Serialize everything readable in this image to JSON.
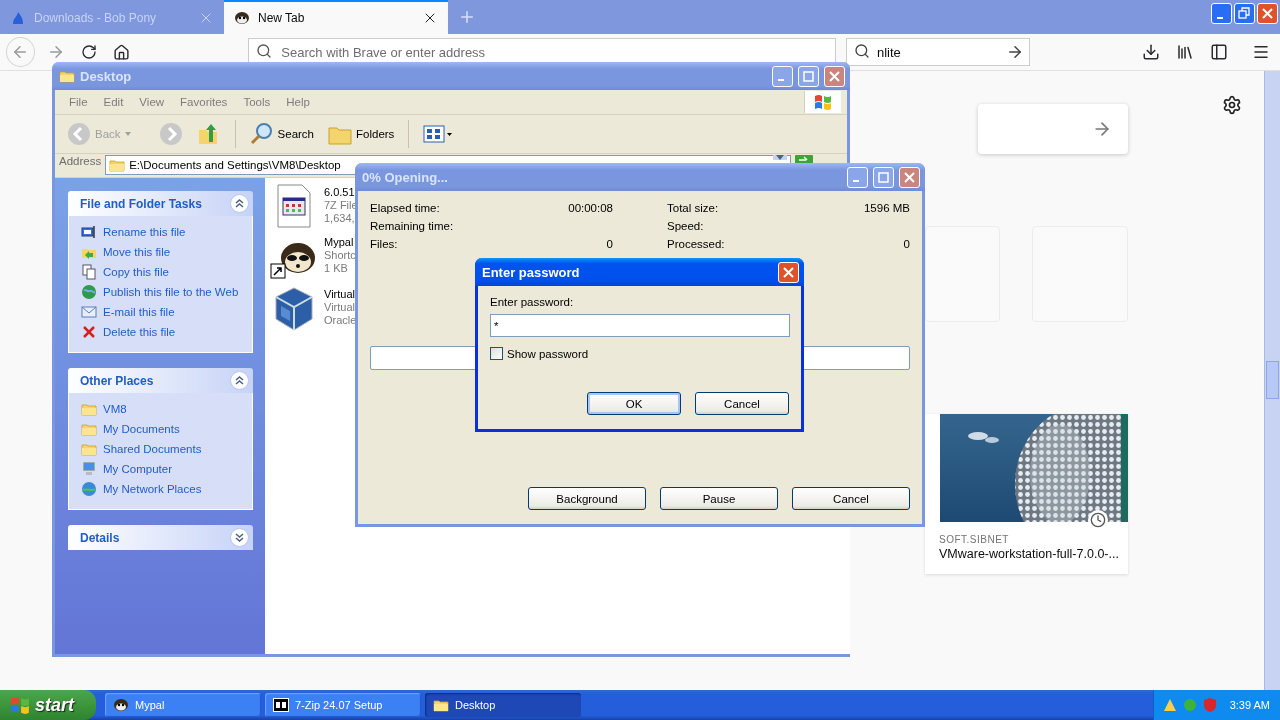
{
  "browser": {
    "tabs": [
      {
        "label": "Downloads - Bob Pony",
        "selected": false,
        "kind": "site"
      },
      {
        "label": "New Tab",
        "selected": true,
        "kind": "mascot"
      }
    ],
    "address": {
      "placeholder": "Search with Brave or enter address"
    },
    "search": {
      "value": "nlite"
    },
    "story": {
      "kind": "picture",
      "source": "SOFT.SIBNET",
      "title": "VMware-workstation-full-7.0.0-..."
    }
  },
  "explorer": {
    "title": "Desktop",
    "menu": [
      "File",
      "Edit",
      "View",
      "Favorites",
      "Tools",
      "Help"
    ],
    "toolbar": {
      "back": "Back",
      "search": "Search",
      "folders": "Folders"
    },
    "address_label": "Address",
    "address": "E:\\Documents and Settings\\VM8\\Desktop",
    "panels": [
      {
        "title": "File and Folder Tasks",
        "expanded": true,
        "items": [
          {
            "label": "Rename this file",
            "kind": "rename"
          },
          {
            "label": "Move this file",
            "kind": "move"
          },
          {
            "label": "Copy this file",
            "kind": "copy"
          },
          {
            "label": "Publish this file to the Web",
            "kind": "publish"
          },
          {
            "label": "E-mail this file",
            "kind": "email"
          },
          {
            "label": "Delete this file",
            "kind": "delete"
          }
        ]
      },
      {
        "title": "Other Places",
        "expanded": true,
        "items": [
          {
            "label": "VM8",
            "kind": "folder"
          },
          {
            "label": "My Documents",
            "kind": "folder"
          },
          {
            "label": "Shared Documents",
            "kind": "folder"
          },
          {
            "label": "My Computer",
            "kind": "computer"
          },
          {
            "label": "My Network Places",
            "kind": "network"
          }
        ]
      },
      {
        "title": "Details",
        "expanded": false
      }
    ],
    "files": [
      {
        "kind": "archive",
        "lines": [
          "6.0.51",
          "7Z File",
          "1,634,"
        ]
      },
      {
        "kind": "shortcut",
        "lines": [
          "Mypal",
          "Shortc",
          "1 KB"
        ]
      },
      {
        "kind": "installer",
        "lines": [
          "Virtual",
          "Virtual",
          "Oracle"
        ]
      }
    ]
  },
  "progress": {
    "title": "0% Opening...",
    "stats": [
      {
        "label": "Elapsed time:",
        "value": "00:00:08"
      },
      {
        "label": "Total size:",
        "value": "1596 MB"
      },
      {
        "label": "Remaining time:"
      },
      {
        "label": "Speed:"
      },
      {
        "label": "Files:",
        "value": "0"
      },
      {
        "label": "Processed:",
        "value": "0"
      }
    ],
    "level": 0,
    "buttons": [
      "Background",
      "Pause",
      "Cancel"
    ]
  },
  "password": {
    "title": "Enter password",
    "label": "Enter password:",
    "value": "*",
    "show_password": {
      "label": "Show password",
      "checked": false
    },
    "buttons": [
      "OK",
      "Cancel"
    ]
  },
  "taskbar": {
    "start": "start",
    "tasks": [
      {
        "label": "Mypal",
        "kind": "mascot",
        "selected": false
      },
      {
        "label": "7-Zip 24.07 Setup",
        "kind": "archive",
        "selected": false
      },
      {
        "label": "Desktop",
        "kind": "folder",
        "selected": true
      }
    ],
    "clock": "3:39 AM"
  }
}
